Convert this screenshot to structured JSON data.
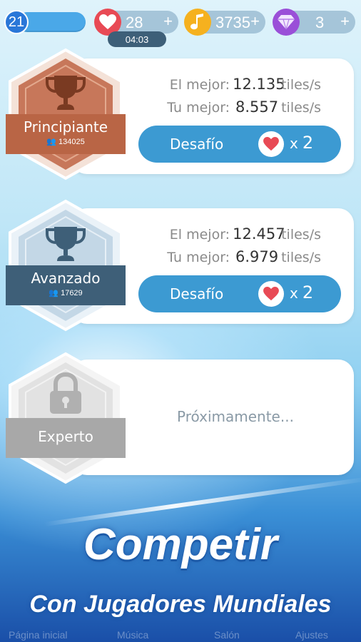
{
  "topbar": {
    "level": "21",
    "lives": "28",
    "lives_plus": "+",
    "timer": "04:03",
    "notes": "3735",
    "notes_plus": "+",
    "gems": "3",
    "gems_plus": "+"
  },
  "levels": [
    {
      "name": "Principiante",
      "players": "134025",
      "best_label": "El mejor:",
      "best_value": "12.135",
      "your_label": "Tu mejor:",
      "your_value": "8.557",
      "unit": "tiles/s",
      "button": "Desafío",
      "cost_x": "x",
      "cost": "2",
      "colors": {
        "hex": "#c46e4c",
        "ribbon": "#b5623f"
      }
    },
    {
      "name": "Avanzado",
      "players": "17629",
      "best_label": "El mejor:",
      "best_value": "12.457",
      "your_label": "Tu mejor:",
      "your_value": "6.979",
      "unit": "tiles/s",
      "button": "Desafío",
      "cost_x": "x",
      "cost": "2",
      "colors": {
        "hex": "#c6d8e6",
        "ribbon": "#3e5f78"
      }
    },
    {
      "name": "Experto",
      "coming_soon": "Próximamente...",
      "colors": {
        "hex": "#e3e3e3",
        "ribbon": "#a8a8a8"
      }
    }
  ],
  "promo": {
    "title": "Competir",
    "subtitle": "Con Jugadores Mundiales"
  },
  "bottom_nav": [
    "Página inicial",
    "Música",
    "Salón",
    "Ajustes"
  ],
  "icons": {
    "level": "level-circle",
    "lives": "heart-icon",
    "notes": "music-note-icon",
    "gems": "diamond-icon",
    "trophy": "trophy-icon",
    "lock": "lock-icon",
    "players": "people-icon"
  }
}
